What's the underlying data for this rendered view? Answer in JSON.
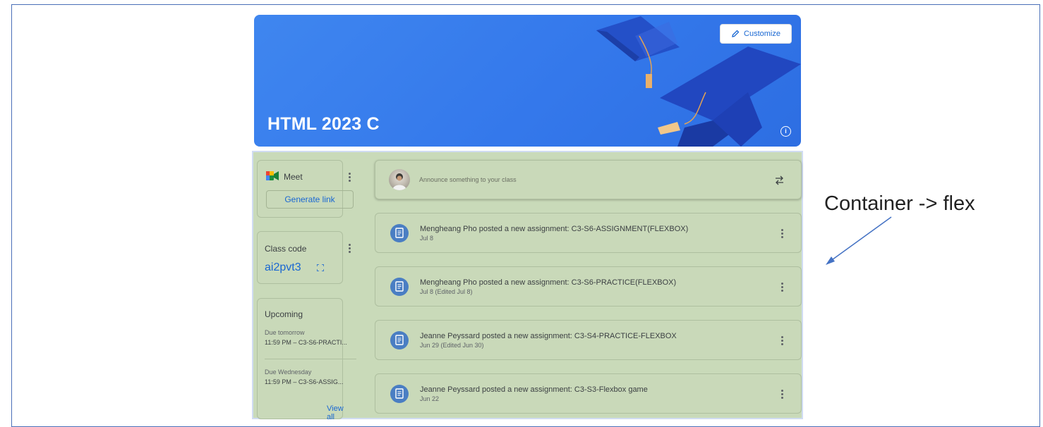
{
  "banner": {
    "class_title": "HTML 2023 C",
    "customize_label": "Customize",
    "color": "#3a7ded"
  },
  "meet": {
    "label": "Meet",
    "generate_link_label": "Generate link"
  },
  "class_code": {
    "label": "Class code",
    "value": "ai2pvt3"
  },
  "upcoming": {
    "label": "Upcoming",
    "items": [
      {
        "due": "Due tomorrow",
        "text": "11:59 PM – C3-S6-PRACTI..."
      },
      {
        "due": "Due Wednesday",
        "text": "11:59 PM – C3-S6-ASSIG..."
      }
    ],
    "view_all_label": "View all"
  },
  "announce": {
    "placeholder": "Announce something to your class"
  },
  "posts": [
    {
      "title": "Mengheang Pho posted a new assignment: C3-S6-ASSIGNMENT(FLEXBOX)",
      "date": "Jul 8"
    },
    {
      "title": "Mengheang Pho posted a new assignment: C3-S6-PRACTICE(FLEXBOX)",
      "date": "Jul 8 (Edited Jul 8)"
    },
    {
      "title": "Jeanne Peyssard posted a new assignment: C3-S4-PRACTICE-FLEXBOX",
      "date": "Jun 29 (Edited Jun 30)"
    },
    {
      "title": "Jeanne Peyssard posted a new assignment: C3-S3-Flexbox game",
      "date": "Jun 22"
    }
  ],
  "annotation": {
    "text": "Container -> flex"
  },
  "icons": {
    "customize": "pencil-icon",
    "info": "info-icon",
    "meet": "meet-logo-icon",
    "kebab": "more-vert-icon",
    "class_code_expand": "fullscreen-icon",
    "repost": "repost-icon",
    "post": "assignment-icon"
  }
}
